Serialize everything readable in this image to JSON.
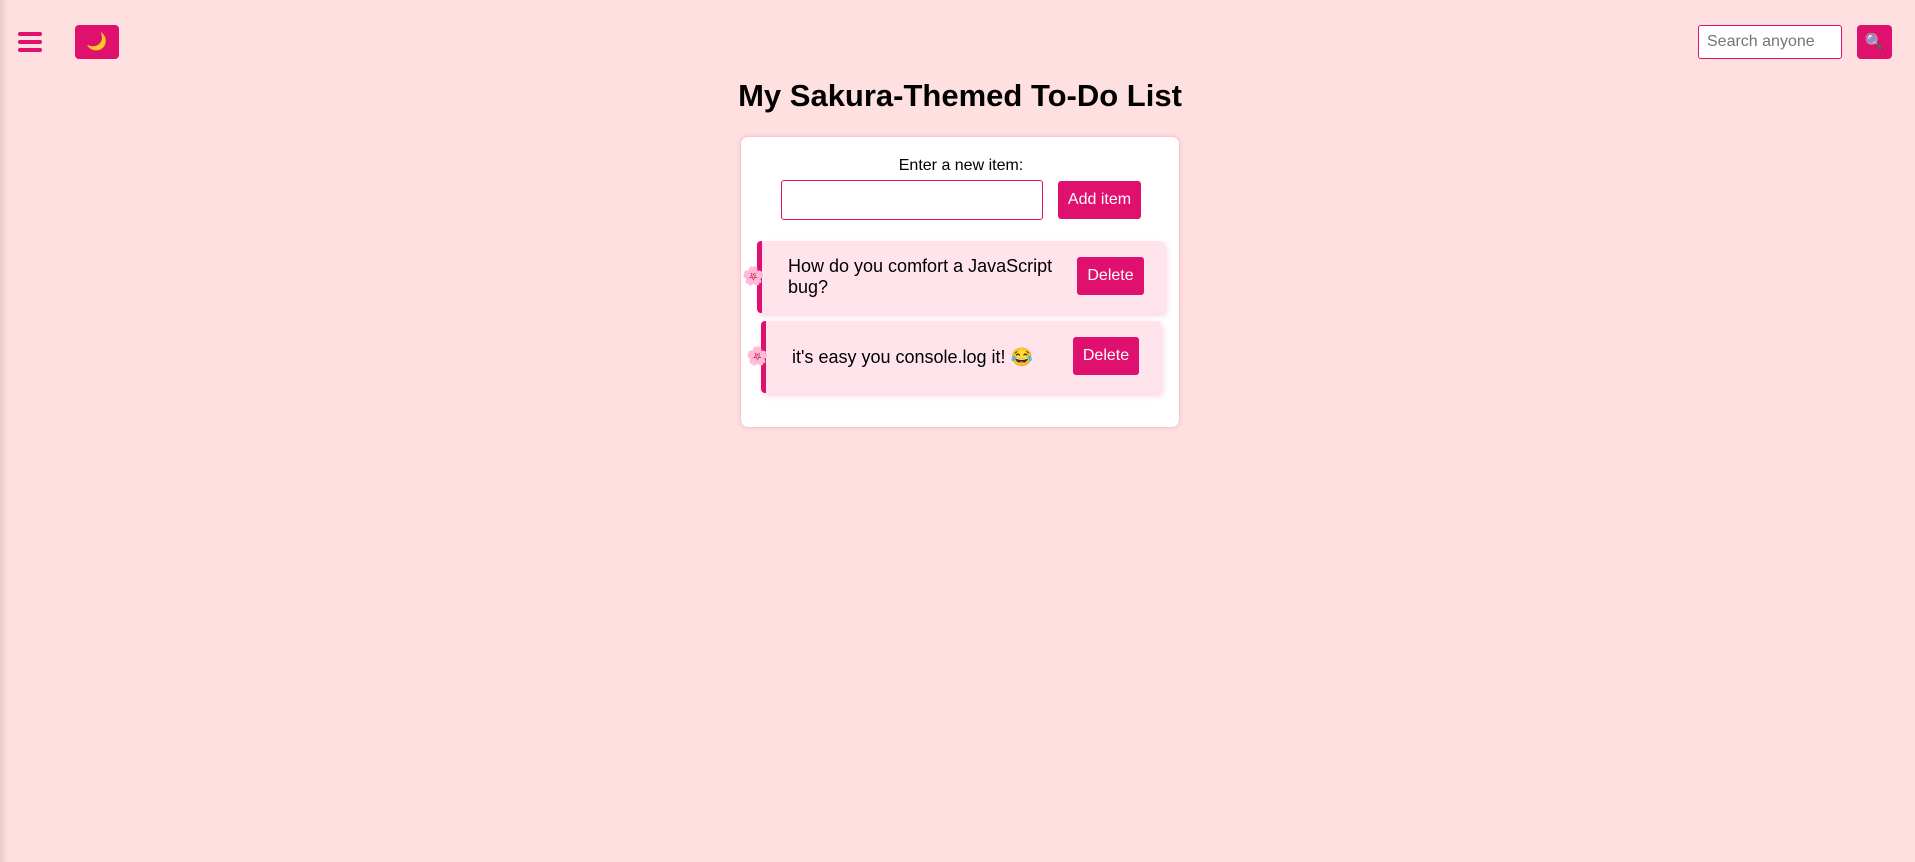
{
  "header": {
    "theme_toggle_icon": "🌙",
    "search_placeholder": "Search anyone",
    "search_button_icon": "🔍"
  },
  "title": "My Sakura-Themed To-Do List",
  "form": {
    "label": "Enter a new item:",
    "input_value": "",
    "add_button_label": "Add item"
  },
  "todos": [
    {
      "text": "How do you comfort a JavaScript bug?",
      "delete_label": "Delete",
      "marker_icon": "🌸"
    },
    {
      "text": "it's easy you console.log it! 😂",
      "delete_label": "Delete",
      "marker_icon": "🌸"
    }
  ],
  "colors": {
    "background": "#ffe0e0",
    "accent": "#e0106e",
    "item_background": "#ffe4ec"
  }
}
